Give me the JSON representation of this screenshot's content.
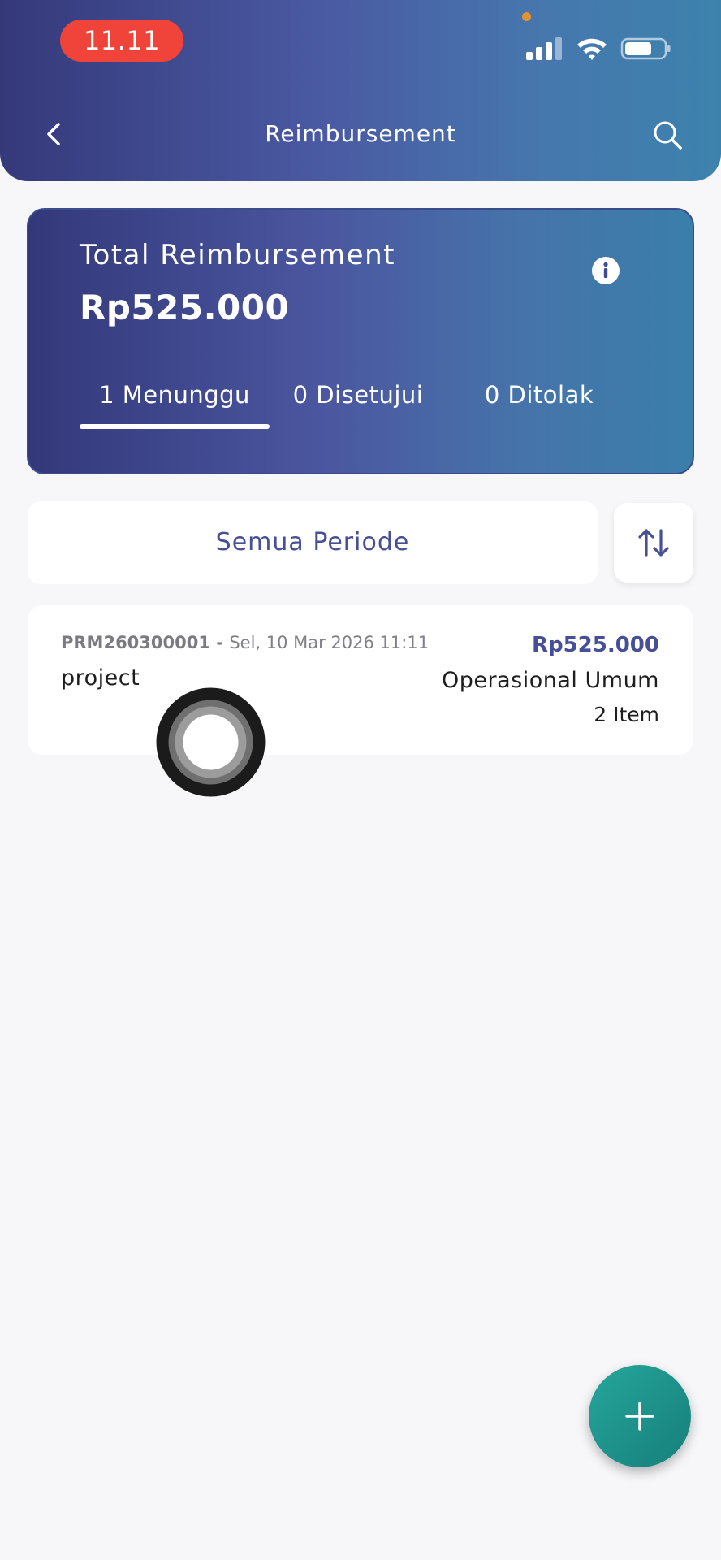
{
  "status_bar": {
    "time": "11.11",
    "icons": [
      "signal-icon",
      "wifi-icon",
      "battery-icon"
    ]
  },
  "header": {
    "title": "Reimbursement",
    "back_icon": "chevron-left-icon",
    "search_icon": "search-icon"
  },
  "summary": {
    "label": "Total Reimbursement",
    "amount": "Rp525.000",
    "info_icon": "info-icon",
    "tabs": [
      {
        "label": "1 Menunggu",
        "selected": true
      },
      {
        "label": "0 Disetujui",
        "selected": false
      },
      {
        "label": "0 Ditolak",
        "selected": false
      }
    ]
  },
  "filter": {
    "period_label": "Semua Periode",
    "sort_icon": "sort-arrows-icon"
  },
  "items": [
    {
      "code": "PRM260300001",
      "separator": " - ",
      "date": "Sel, 10 Mar 2026 11:11",
      "name": "project",
      "amount": "Rp525.000",
      "category": "Operasional Umum",
      "count": "2 Item"
    }
  ],
  "fab": {
    "icon": "plus-icon"
  },
  "colors": {
    "accent": "#474f96",
    "fab": "#1f9a91",
    "status_pill": "#f0433a",
    "background": "#f7f6f9"
  }
}
